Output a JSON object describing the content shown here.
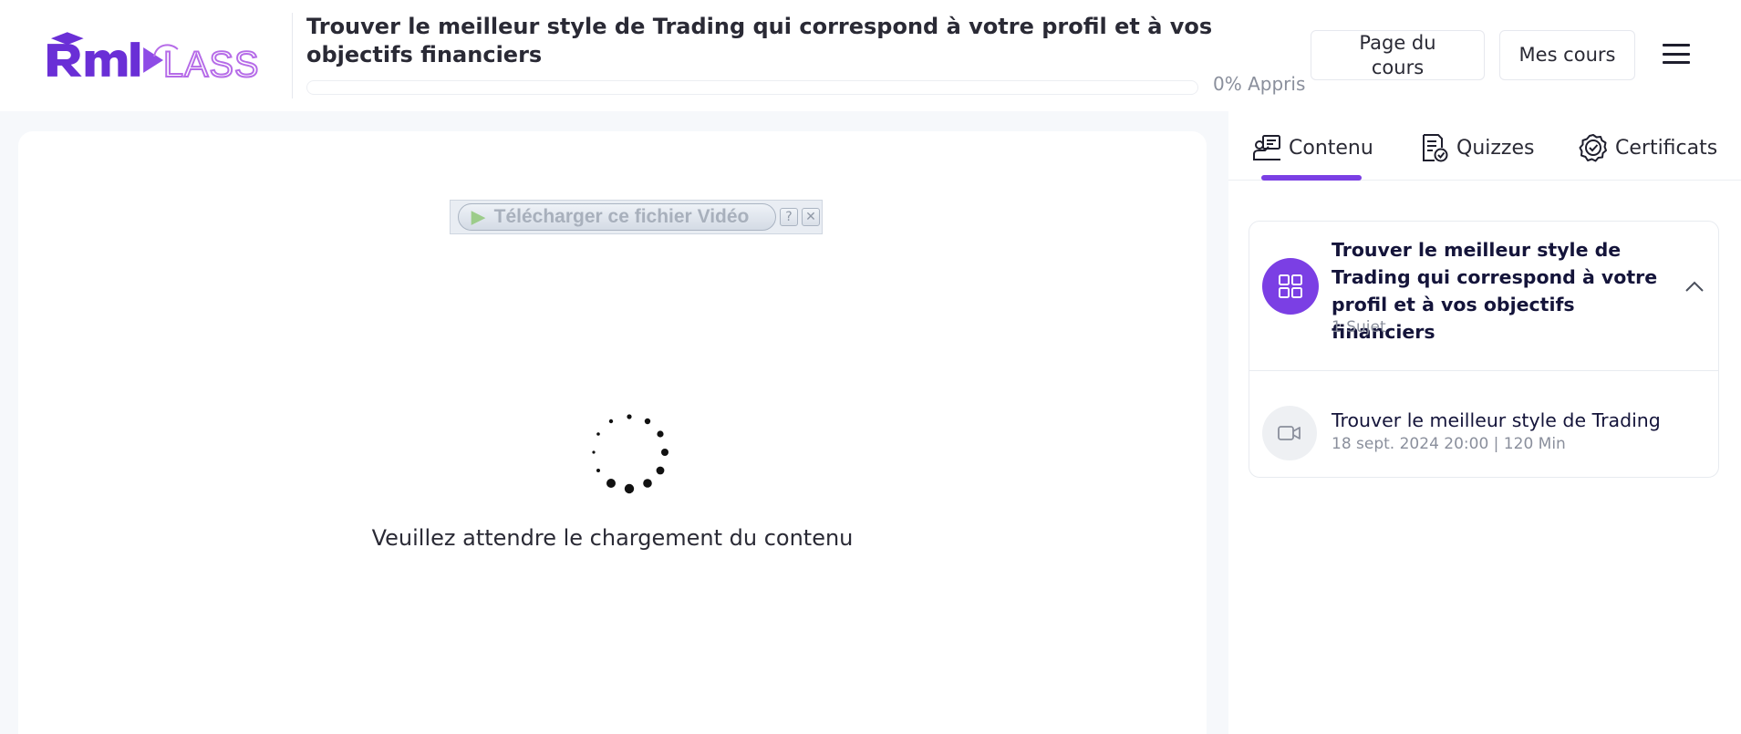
{
  "header": {
    "logo_text": "RMICLASS",
    "course_title": "Trouver le meilleur style de Trading qui correspond à votre profil et à vos objectifs financiers",
    "progress_value": 0,
    "progress_label": "0% Appris",
    "page_du_cours": "Page du cours",
    "mes_cours": "Mes cours",
    "menu_icon": "hamburger-icon"
  },
  "content": {
    "download_label": "Télécharger ce fichier Vidéo",
    "download_help": "?",
    "download_close": "✕",
    "loading_text": "Veuillez attendre le chargement du contenu"
  },
  "sidebar": {
    "tabs": [
      {
        "label": "Contenu",
        "icon": "content-icon",
        "active": true
      },
      {
        "label": "Quizzes",
        "icon": "quiz-icon",
        "active": false
      },
      {
        "label": "Certificats",
        "icon": "certificate-icon",
        "active": false
      }
    ],
    "section": {
      "title": "Trouver le meilleur style de Trading qui correspond à votre profil et à vos objectifs financiers",
      "subtitle": "1 Sujet",
      "icon": "grid-icon"
    },
    "lesson": {
      "title": "Trouver le meilleur style de Trading",
      "meta": "18 sept. 2024 20:00 | 120 Min",
      "icon": "video-icon"
    }
  },
  "colors": {
    "accent": "#7b3fe4",
    "logo_dark": "#6a2fd6",
    "logo_light": "#b66ce8"
  }
}
